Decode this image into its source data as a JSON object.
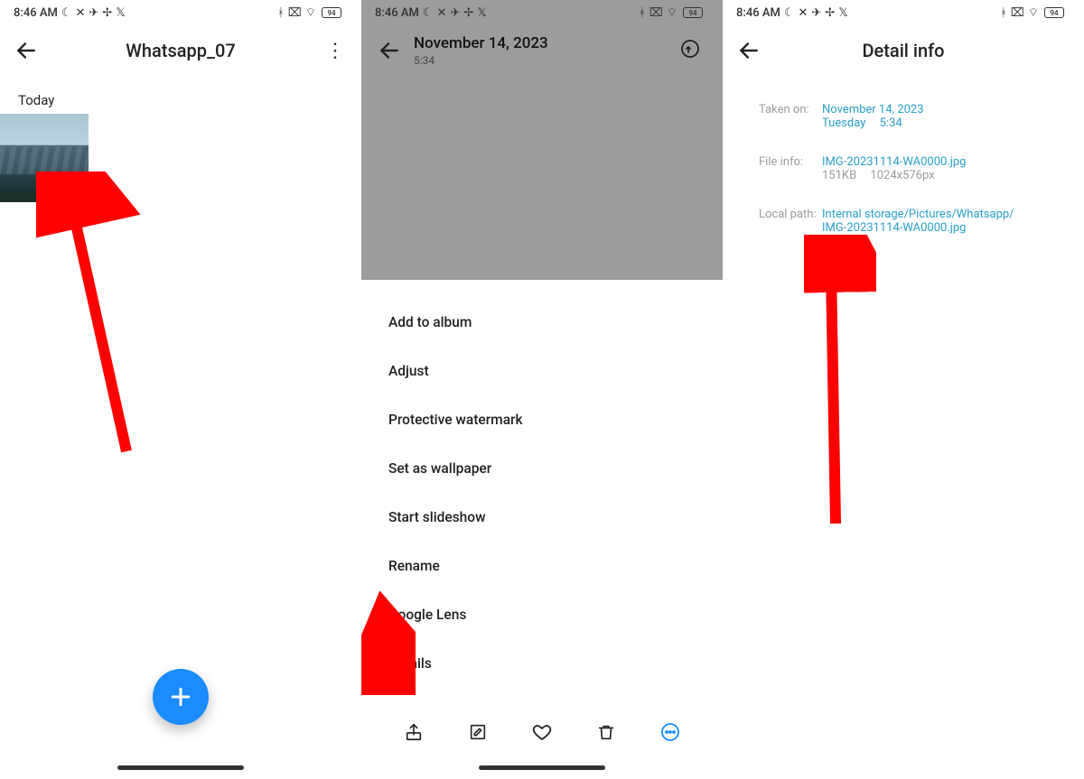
{
  "status": {
    "time": "8:46 AM",
    "battery": "94"
  },
  "screen1": {
    "title": "Whatsapp_07",
    "section": "Today"
  },
  "screen2": {
    "date": "November 14, 2023",
    "time": "5:34",
    "menu": [
      "Add to album",
      "Adjust",
      "Protective watermark",
      "Set as wallpaper",
      "Start slideshow",
      "Rename",
      "Google Lens",
      "Details"
    ]
  },
  "screen3": {
    "title": "Detail info",
    "labels": {
      "taken": "Taken on:",
      "file": "File info:",
      "path": "Local path:"
    },
    "taken": {
      "date": "November 14, 2023",
      "day": "Tuesday",
      "time": "5:34"
    },
    "file": {
      "name": "IMG-20231114-WA0000.jpg",
      "size": "151KB",
      "dims": "1024x576px"
    },
    "path": {
      "line1": "Internal storage/Pictures/Whatsapp/",
      "line2": "IMG-20231114-WA0000.jpg"
    }
  }
}
